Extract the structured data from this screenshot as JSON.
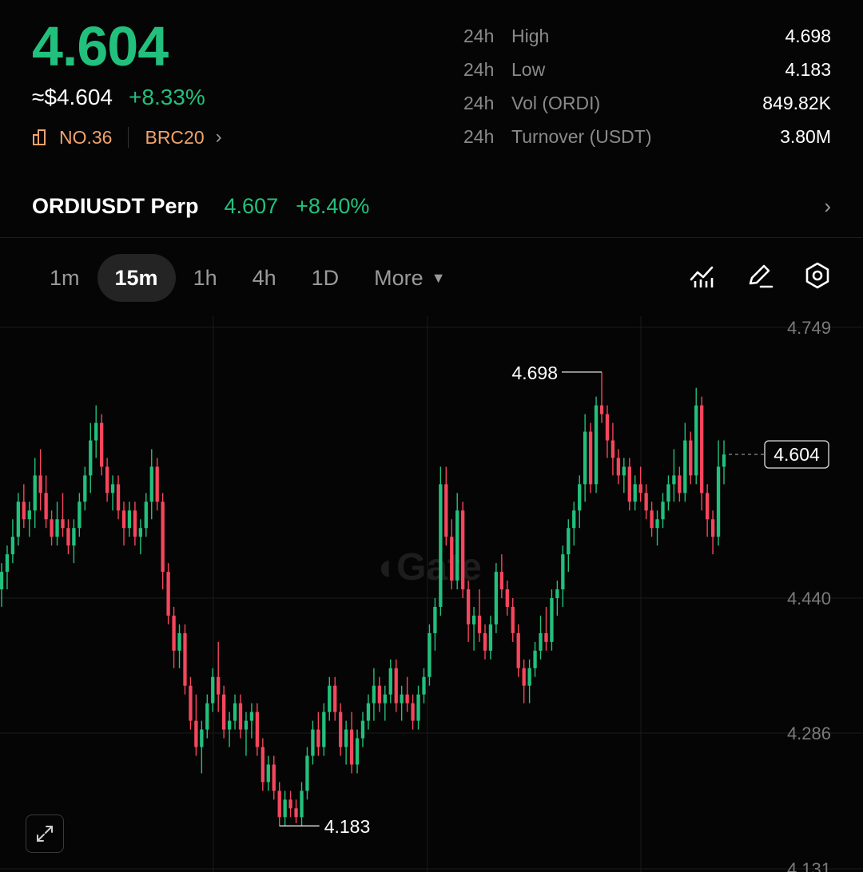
{
  "ticker": {
    "price": "4.604",
    "usd_price": "≈$4.604",
    "change_pct": "+8.33%",
    "rank": "NO.36",
    "category": "BRC20"
  },
  "stats": [
    {
      "period": "24h",
      "label": "High",
      "value": "4.698"
    },
    {
      "period": "24h",
      "label": "Low",
      "value": "4.183"
    },
    {
      "period": "24h",
      "label": "Vol (ORDI)",
      "value": "849.82K"
    },
    {
      "period": "24h",
      "label": "Turnover (USDT)",
      "value": "3.80M"
    }
  ],
  "perp": {
    "name": "ORDIUSDT Perp",
    "price": "4.607",
    "change_pct": "+8.40%"
  },
  "intervals": {
    "items": [
      "1m",
      "15m",
      "1h",
      "4h",
      "1D"
    ],
    "active": "15m",
    "more_label": "More"
  },
  "icons": {
    "rank": "rank-chart-icon",
    "indicators": "indicators-icon",
    "draw": "pencil-icon",
    "settings": "hexagon-settings-icon",
    "expand": "expand-icon",
    "watermark": "gate-logo"
  },
  "colors": {
    "up": "#22c07d",
    "down": "#f6465d",
    "tag": "#f0a36b"
  },
  "chart_data": {
    "type": "candlestick",
    "interval": "15m",
    "y_tick_labels": [
      "4.749",
      "4.440",
      "4.286",
      "4.131"
    ],
    "ylim": [
      4.131,
      4.749
    ],
    "annotations": {
      "high": "4.698",
      "low": "4.183",
      "last": "4.604"
    },
    "grid": true,
    "candles": [
      [
        4.45,
        4.48,
        4.43,
        4.47
      ],
      [
        4.47,
        4.5,
        4.45,
        4.49
      ],
      [
        4.49,
        4.53,
        4.48,
        4.51
      ],
      [
        4.51,
        4.56,
        4.5,
        4.55
      ],
      [
        4.55,
        4.57,
        4.52,
        4.53
      ],
      [
        4.53,
        4.55,
        4.51,
        4.54
      ],
      [
        4.54,
        4.6,
        4.52,
        4.58
      ],
      [
        4.58,
        4.61,
        4.54,
        4.56
      ],
      [
        4.56,
        4.58,
        4.52,
        4.53
      ],
      [
        4.53,
        4.54,
        4.5,
        4.51
      ],
      [
        4.51,
        4.55,
        4.5,
        4.53
      ],
      [
        4.53,
        4.56,
        4.51,
        4.52
      ],
      [
        4.52,
        4.53,
        4.49,
        4.5
      ],
      [
        4.5,
        4.53,
        4.48,
        4.52
      ],
      [
        4.52,
        4.56,
        4.51,
        4.55
      ],
      [
        4.55,
        4.59,
        4.54,
        4.58
      ],
      [
        4.58,
        4.64,
        4.56,
        4.62
      ],
      [
        4.62,
        4.66,
        4.6,
        4.64
      ],
      [
        4.64,
        4.65,
        4.58,
        4.59
      ],
      [
        4.59,
        4.6,
        4.55,
        4.56
      ],
      [
        4.56,
        4.58,
        4.54,
        4.57
      ],
      [
        4.57,
        4.58,
        4.53,
        4.54
      ],
      [
        4.54,
        4.55,
        4.5,
        4.52
      ],
      [
        4.52,
        4.55,
        4.51,
        4.54
      ],
      [
        4.54,
        4.55,
        4.5,
        4.51
      ],
      [
        4.51,
        4.53,
        4.49,
        4.52
      ],
      [
        4.52,
        4.56,
        4.51,
        4.55
      ],
      [
        4.55,
        4.61,
        4.53,
        4.59
      ],
      [
        4.59,
        4.6,
        4.54,
        4.55
      ],
      [
        4.55,
        4.56,
        4.45,
        4.47
      ],
      [
        4.47,
        4.48,
        4.41,
        4.42
      ],
      [
        4.42,
        4.43,
        4.36,
        4.38
      ],
      [
        4.38,
        4.41,
        4.36,
        4.4
      ],
      [
        4.4,
        4.41,
        4.33,
        4.34
      ],
      [
        4.34,
        4.35,
        4.29,
        4.3
      ],
      [
        4.3,
        4.33,
        4.26,
        4.27
      ],
      [
        4.27,
        4.3,
        4.24,
        4.29
      ],
      [
        4.29,
        4.33,
        4.28,
        4.32
      ],
      [
        4.32,
        4.36,
        4.31,
        4.35
      ],
      [
        4.35,
        4.39,
        4.31,
        4.33
      ],
      [
        4.33,
        4.34,
        4.28,
        4.29
      ],
      [
        4.29,
        4.31,
        4.27,
        4.3
      ],
      [
        4.3,
        4.33,
        4.29,
        4.32
      ],
      [
        4.32,
        4.33,
        4.28,
        4.29
      ],
      [
        4.29,
        4.31,
        4.26,
        4.3
      ],
      [
        4.3,
        4.32,
        4.28,
        4.31
      ],
      [
        4.31,
        4.32,
        4.26,
        4.27
      ],
      [
        4.27,
        4.28,
        4.22,
        4.23
      ],
      [
        4.23,
        4.26,
        4.22,
        4.25
      ],
      [
        4.25,
        4.26,
        4.21,
        4.22
      ],
      [
        4.22,
        4.23,
        4.18,
        4.19
      ],
      [
        4.19,
        4.22,
        4.18,
        4.21
      ],
      [
        4.21,
        4.22,
        4.19,
        4.2
      ],
      [
        4.2,
        4.21,
        4.183,
        4.19
      ],
      [
        4.19,
        4.23,
        4.18,
        4.22
      ],
      [
        4.22,
        4.27,
        4.21,
        4.26
      ],
      [
        4.26,
        4.3,
        4.25,
        4.29
      ],
      [
        4.29,
        4.31,
        4.26,
        4.27
      ],
      [
        4.27,
        4.32,
        4.26,
        4.31
      ],
      [
        4.31,
        4.35,
        4.3,
        4.34
      ],
      [
        4.34,
        4.35,
        4.3,
        4.31
      ],
      [
        4.31,
        4.32,
        4.26,
        4.27
      ],
      [
        4.27,
        4.3,
        4.25,
        4.29
      ],
      [
        4.29,
        4.31,
        4.24,
        4.25
      ],
      [
        4.25,
        4.29,
        4.24,
        4.28
      ],
      [
        4.28,
        4.31,
        4.27,
        4.3
      ],
      [
        4.3,
        4.33,
        4.29,
        4.32
      ],
      [
        4.32,
        4.36,
        4.3,
        4.34
      ],
      [
        4.34,
        4.35,
        4.31,
        4.32
      ],
      [
        4.32,
        4.34,
        4.3,
        4.33
      ],
      [
        4.33,
        4.37,
        4.32,
        4.36
      ],
      [
        4.36,
        4.37,
        4.31,
        4.32
      ],
      [
        4.32,
        4.34,
        4.3,
        4.33
      ],
      [
        4.33,
        4.35,
        4.31,
        4.32
      ],
      [
        4.32,
        4.33,
        4.29,
        4.3
      ],
      [
        4.3,
        4.34,
        4.29,
        4.33
      ],
      [
        4.33,
        4.36,
        4.32,
        4.35
      ],
      [
        4.35,
        4.41,
        4.34,
        4.4
      ],
      [
        4.4,
        4.44,
        4.38,
        4.43
      ],
      [
        4.43,
        4.59,
        4.42,
        4.57
      ],
      [
        4.57,
        4.59,
        4.5,
        4.51
      ],
      [
        4.51,
        4.53,
        4.45,
        4.46
      ],
      [
        4.46,
        4.56,
        4.45,
        4.54
      ],
      [
        4.54,
        4.55,
        4.44,
        4.45
      ],
      [
        4.45,
        4.46,
        4.39,
        4.41
      ],
      [
        4.41,
        4.43,
        4.38,
        4.42
      ],
      [
        4.42,
        4.45,
        4.39,
        4.4
      ],
      [
        4.4,
        4.41,
        4.37,
        4.38
      ],
      [
        4.38,
        4.42,
        4.37,
        4.41
      ],
      [
        4.41,
        4.48,
        4.4,
        4.47
      ],
      [
        4.47,
        4.49,
        4.44,
        4.45
      ],
      [
        4.45,
        4.46,
        4.42,
        4.43
      ],
      [
        4.43,
        4.44,
        4.39,
        4.4
      ],
      [
        4.4,
        4.41,
        4.35,
        4.36
      ],
      [
        4.36,
        4.37,
        4.32,
        4.34
      ],
      [
        4.34,
        4.37,
        4.32,
        4.36
      ],
      [
        4.36,
        4.39,
        4.35,
        4.38
      ],
      [
        4.38,
        4.42,
        4.37,
        4.4
      ],
      [
        4.4,
        4.43,
        4.38,
        4.39
      ],
      [
        4.39,
        4.45,
        4.38,
        4.44
      ],
      [
        4.44,
        4.46,
        4.42,
        4.45
      ],
      [
        4.45,
        4.5,
        4.43,
        4.49
      ],
      [
        4.49,
        4.53,
        4.47,
        4.52
      ],
      [
        4.52,
        4.55,
        4.5,
        4.54
      ],
      [
        4.54,
        4.58,
        4.52,
        4.57
      ],
      [
        4.57,
        4.65,
        4.55,
        4.63
      ],
      [
        4.63,
        4.64,
        4.56,
        4.57
      ],
      [
        4.57,
        4.67,
        4.56,
        4.66
      ],
      [
        4.66,
        4.698,
        4.64,
        4.65
      ],
      [
        4.65,
        4.66,
        4.6,
        4.62
      ],
      [
        4.62,
        4.64,
        4.58,
        4.6
      ],
      [
        4.6,
        4.61,
        4.57,
        4.58
      ],
      [
        4.58,
        4.6,
        4.56,
        4.59
      ],
      [
        4.59,
        4.6,
        4.54,
        4.55
      ],
      [
        4.55,
        4.58,
        4.54,
        4.57
      ],
      [
        4.57,
        4.59,
        4.55,
        4.56
      ],
      [
        4.56,
        4.57,
        4.53,
        4.54
      ],
      [
        4.54,
        4.55,
        4.51,
        4.52
      ],
      [
        4.52,
        4.54,
        4.5,
        4.53
      ],
      [
        4.53,
        4.56,
        4.52,
        4.55
      ],
      [
        4.55,
        4.58,
        4.54,
        4.57
      ],
      [
        4.57,
        4.61,
        4.55,
        4.58
      ],
      [
        4.58,
        4.59,
        4.55,
        4.56
      ],
      [
        4.56,
        4.64,
        4.55,
        4.62
      ],
      [
        4.62,
        4.63,
        4.57,
        4.58
      ],
      [
        4.58,
        4.68,
        4.57,
        4.66
      ],
      [
        4.66,
        4.67,
        4.54,
        4.56
      ],
      [
        4.56,
        4.57,
        4.51,
        4.53
      ],
      [
        4.53,
        4.54,
        4.49,
        4.51
      ],
      [
        4.51,
        4.62,
        4.5,
        4.59
      ],
      [
        4.59,
        4.62,
        4.57,
        4.604
      ]
    ]
  }
}
